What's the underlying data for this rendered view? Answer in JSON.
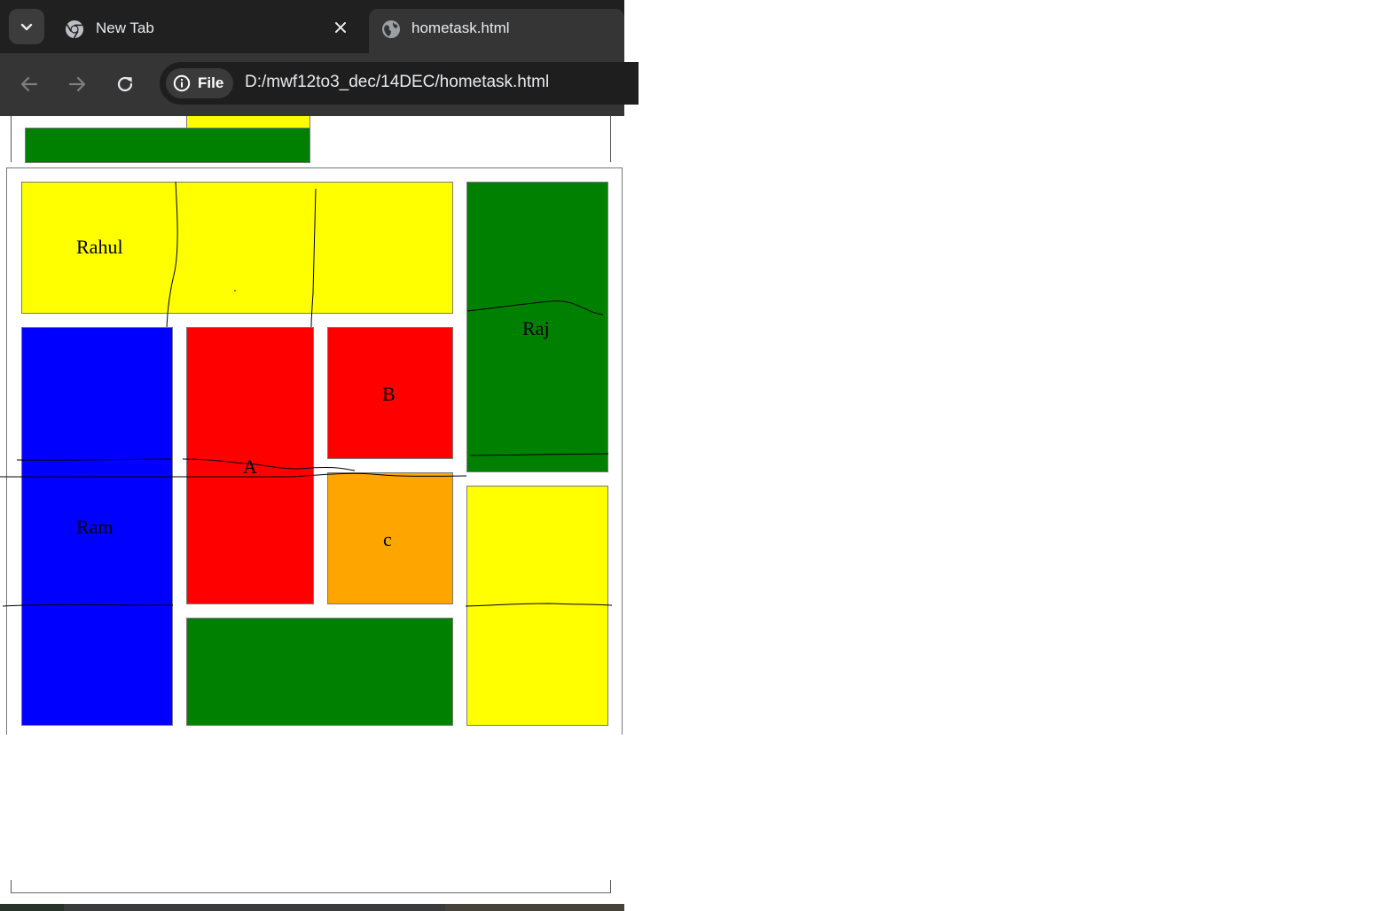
{
  "browser": {
    "tabs": [
      {
        "label": "New Tab",
        "icon": "chrome-icon"
      },
      {
        "label": "hometask.html",
        "icon": "globe-icon"
      }
    ],
    "chip_label": "File",
    "url": "D:/mwf12to3_dec/14DEC/hometask.html"
  },
  "page": {
    "boxes": {
      "rahul": "Rahul",
      "raj": "Raj",
      "ram": "Ram",
      "a": "A",
      "b": "B",
      "c": "c"
    },
    "colors": {
      "yellow": "#ffff00",
      "green": "#008000",
      "blue": "#0000ff",
      "red": "#ff0000",
      "orange": "#ffa500"
    }
  }
}
